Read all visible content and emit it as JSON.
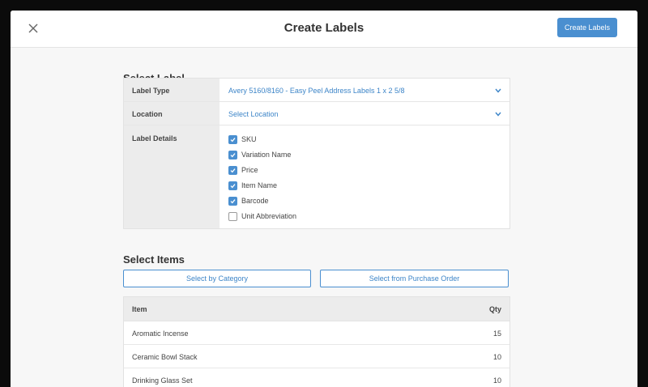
{
  "header": {
    "title": "Create Labels",
    "primary_button": "Create Labels"
  },
  "select_label": {
    "title": "Select Label",
    "label_type": {
      "label": "Label Type",
      "value": "Avery 5160/8160 - Easy Peel Address Labels 1 x 2 5/8"
    },
    "location": {
      "label": "Location",
      "value": "Select Location"
    },
    "label_details": {
      "label": "Label Details",
      "options": [
        {
          "name": "SKU",
          "checked": true
        },
        {
          "name": "Variation Name",
          "checked": true
        },
        {
          "name": "Price",
          "checked": true
        },
        {
          "name": "Item Name",
          "checked": true
        },
        {
          "name": "Barcode",
          "checked": true
        },
        {
          "name": "Unit Abbreviation",
          "checked": false
        }
      ]
    }
  },
  "select_items": {
    "title": "Select Items",
    "by_category_button": "Select by Category",
    "from_po_button": "Select from Purchase Order",
    "table": {
      "headers": {
        "item": "Item",
        "qty": "Qty"
      },
      "rows": [
        {
          "item": "Aromatic Incense",
          "qty": "15"
        },
        {
          "item": "Ceramic Bowl Stack",
          "qty": "10"
        },
        {
          "item": "Drinking Glass Set",
          "qty": "10"
        }
      ]
    }
  },
  "icons": {
    "close": "close-icon",
    "dropdown": "chevron-down-icon",
    "check": "checkmark-icon"
  },
  "colors": {
    "accent": "#4a8fd0",
    "link": "#3d85c8",
    "header_cell": "#ececec",
    "background": "#f7f7f7"
  }
}
